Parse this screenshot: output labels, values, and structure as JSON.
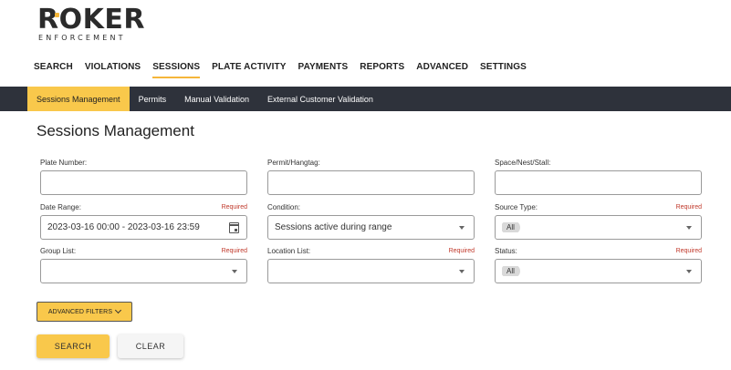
{
  "logo": {
    "main": "ROKER",
    "sub": "ENFORCEMENT"
  },
  "topnav": [
    {
      "label": "SEARCH",
      "active": false
    },
    {
      "label": "VIOLATIONS",
      "active": false
    },
    {
      "label": "SESSIONS",
      "active": true
    },
    {
      "label": "PLATE ACTIVITY",
      "active": false
    },
    {
      "label": "PAYMENTS",
      "active": false
    },
    {
      "label": "REPORTS",
      "active": false
    },
    {
      "label": "ADVANCED",
      "active": false
    },
    {
      "label": "SETTINGS",
      "active": false
    }
  ],
  "subnav": [
    {
      "label": "Sessions Management",
      "active": true
    },
    {
      "label": "Permits",
      "active": false
    },
    {
      "label": "Manual Validation",
      "active": false
    },
    {
      "label": "External Customer Validation",
      "active": false
    }
  ],
  "page_title": "Sessions Management",
  "required_label": "Required",
  "fields": {
    "plate_number": {
      "label": "Plate Number:",
      "value": ""
    },
    "permit_hangtag": {
      "label": "Permit/Hangtag:",
      "value": ""
    },
    "space_nest_stall": {
      "label": "Space/Nest/Stall:",
      "value": ""
    },
    "date_range": {
      "label": "Date Range:",
      "value": "2023-03-16 00:00 - 2023-03-16 23:59"
    },
    "condition": {
      "label": "Condition:",
      "value": "Sessions active during range"
    },
    "source_type": {
      "label": "Source Type:",
      "value": "All"
    },
    "group_list": {
      "label": "Group List:",
      "value": ""
    },
    "location_list": {
      "label": "Location List:",
      "value": ""
    },
    "status": {
      "label": "Status:",
      "value": "All"
    }
  },
  "buttons": {
    "advanced_filters": "ADVANCED FILTERS",
    "search": "SEARCH",
    "clear": "CLEAR"
  },
  "colors": {
    "accent": "#f9c84b",
    "subnav_bg": "#2e323b",
    "required": "#c0392b"
  }
}
